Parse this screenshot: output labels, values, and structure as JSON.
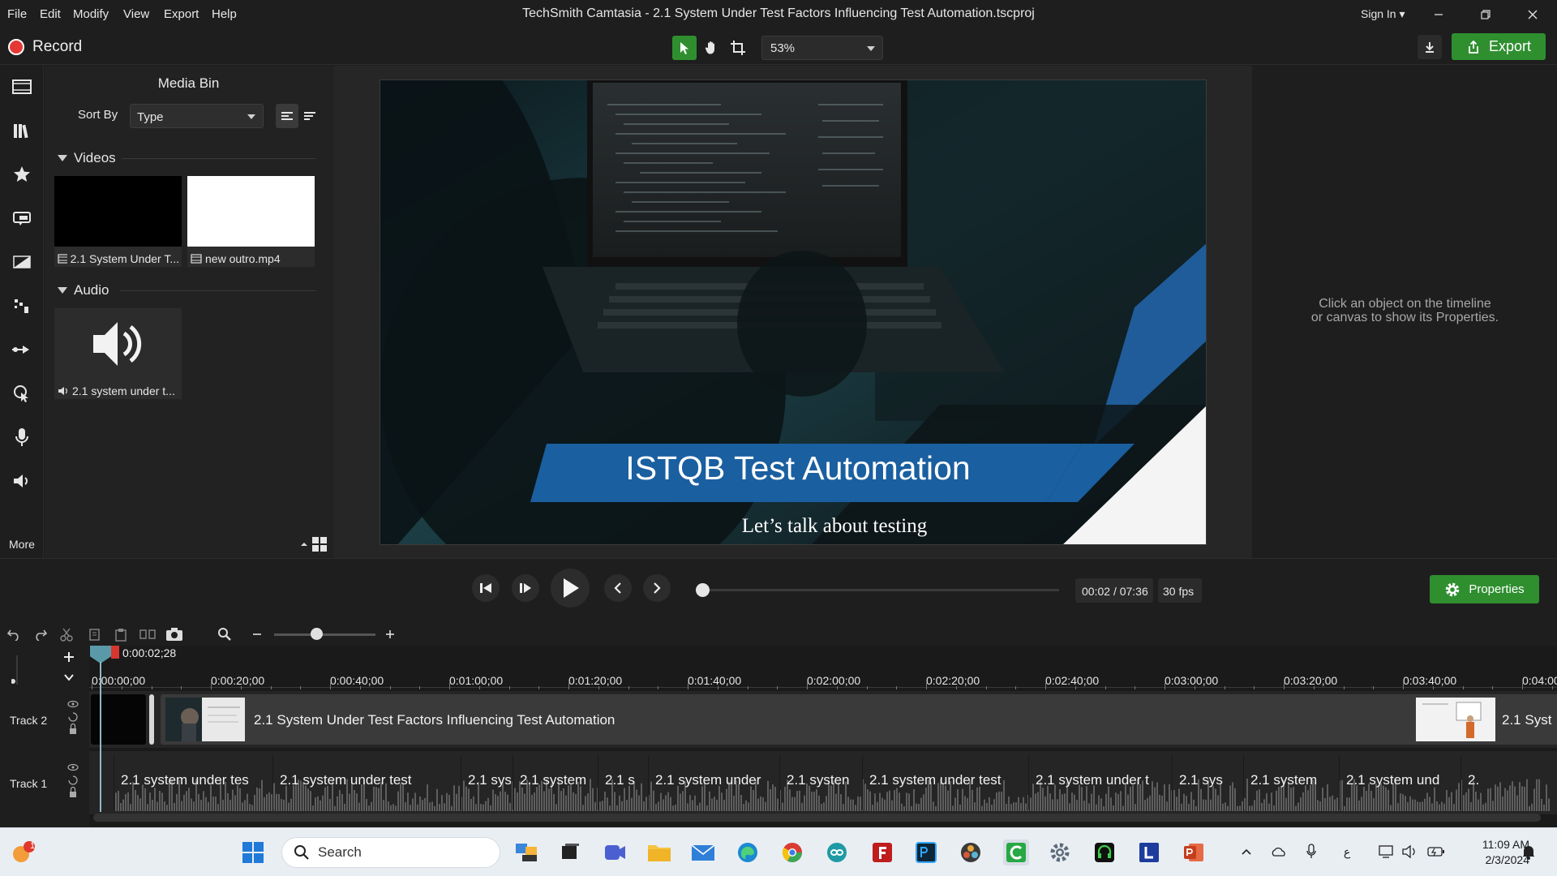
{
  "app": {
    "title": "TechSmith Camtasia - 2.1 System Under Test Factors Influencing Test Automation.tscproj",
    "menu": [
      "File",
      "Edit",
      "Modify",
      "View",
      "Export",
      "Help"
    ],
    "sign_in": "Sign In",
    "accent": "#2f8f2f"
  },
  "toolbar": {
    "record_label": "Record",
    "zoom_value": "53%",
    "export_label": "Export"
  },
  "rail": {
    "items": [
      "media-bin",
      "library",
      "favorites",
      "annotations",
      "transitions",
      "behaviors",
      "animations",
      "cursor-effects",
      "voice-narration",
      "audio-effects"
    ],
    "more_label": "More"
  },
  "media_bin": {
    "title": "Media Bin",
    "sort_by_label": "Sort By",
    "sort_by_value": "Type",
    "videos_header": "Videos",
    "videos": [
      {
        "caption": "2.1 System Under T..."
      },
      {
        "caption": "new outro.mp4"
      }
    ],
    "audio_header": "Audio",
    "audio": [
      {
        "caption": "2.1 system under t..."
      }
    ]
  },
  "canvas": {
    "slide_title": "ISTQB Test Automation",
    "slide_subtitle": "Let’s talk about testing"
  },
  "properties": {
    "hint_line1": "Click an object on the timeline",
    "hint_line2": "or canvas to show its Properties.",
    "button_label": "Properties"
  },
  "playback": {
    "current": "00:02",
    "separator": "/",
    "duration": "07:36",
    "fps": "30 fps",
    "position_fraction": 0.005
  },
  "timeline": {
    "playhead": "0:00:02;28",
    "ticks": [
      "0:00:00;00",
      "0:00:20;00",
      "0:00:40;00",
      "0:01:00;00",
      "0:01:20;00",
      "0:01:40;00",
      "0:02:00;00",
      "0:02:20;00",
      "0:02:40;00",
      "0:03:00;00",
      "0:03:20;00",
      "0:03:40;00",
      "0:04:00;00"
    ],
    "track2_label": "Track 2",
    "track1_label": "Track 1",
    "track2_clip_main": "2.1 System Under Test Factors Influencing Test Automation",
    "track2_clip_end": "2.1 Syst",
    "track1_clips": [
      "2.1 system under tes",
      "2.1 system under test",
      "2.1 sys",
      "2.1 system ",
      "2.1 s",
      "2.1 system under",
      "2.1 systen",
      "2.1 system under test",
      "2.1 system under t",
      "2.1 sys",
      "2.1 system ",
      "2.1 system und",
      "2."
    ]
  },
  "taskbar": {
    "search_placeholder": "Search",
    "time": "11:09 AM",
    "date": "2/3/2024",
    "ime": "ع",
    "notification_badge": "1"
  }
}
